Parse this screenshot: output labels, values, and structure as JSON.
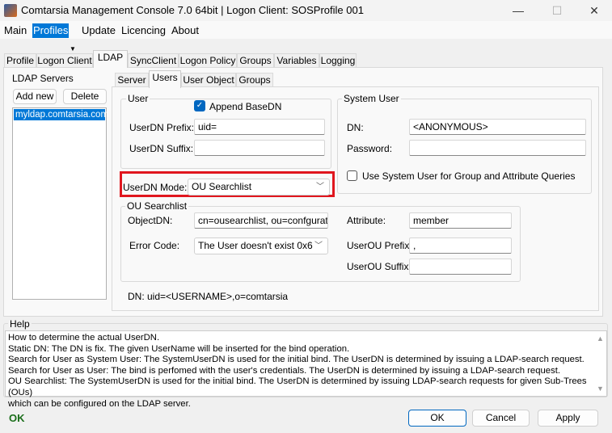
{
  "window": {
    "title": "Comtarsia Management Console 7.0 64bit | Logon Client: SOSProfile 001",
    "minimize": "—",
    "maximize": "☐",
    "close": "✕"
  },
  "menu": [
    {
      "label": "Main"
    },
    {
      "label": "Profiles"
    },
    {
      "label": "Update"
    },
    {
      "label": "Licencing"
    },
    {
      "label": "About"
    }
  ],
  "tabs": [
    {
      "label": "Profile"
    },
    {
      "label": "Logon Client"
    },
    {
      "label": "LDAP"
    },
    {
      "label": "SyncClient"
    },
    {
      "label": "Logon Policy"
    },
    {
      "label": "Groups"
    },
    {
      "label": "Variables"
    },
    {
      "label": "Logging"
    }
  ],
  "ldap_servers": {
    "label": "LDAP Servers",
    "add_button": "Add new",
    "delete_button": "Delete",
    "items": [
      "myldap.comtarsia.com"
    ]
  },
  "subtabs": [
    {
      "label": "Server"
    },
    {
      "label": "Users"
    },
    {
      "label": "User Object"
    },
    {
      "label": "Groups"
    }
  ],
  "user": {
    "group_label": "User",
    "append_basedn_label": "Append BaseDN",
    "append_basedn_checked": true,
    "prefix_label": "UserDN Prefix:",
    "prefix_value": "uid=",
    "suffix_label": "UserDN Suffix:",
    "suffix_value": ""
  },
  "system_user": {
    "group_label": "System User",
    "dn_label": "DN:",
    "dn_value": "<ANONYMOUS>",
    "password_label": "Password:",
    "password_value": "",
    "use_system_label": "Use System User for Group and Attribute Queries",
    "use_system_checked": false
  },
  "userdn_mode": {
    "label": "UserDN Mode:",
    "value": "OU Searchlist",
    "highlight_color": "#e0161e"
  },
  "ou_searchlist": {
    "group_label": "OU Searchlist",
    "objectdn_label": "ObjectDN:",
    "objectdn_value": "cn=ousearchlist, ou=confguration,",
    "error_label": "Error Code:",
    "error_value": "The User doesn't exist 0x6",
    "attribute_label": "Attribute:",
    "attribute_value": "member",
    "ou_prefix_label": "UserOU Prefix:",
    "ou_prefix_value": ",",
    "ou_suffix_label": "UserOU Suffix:",
    "ou_suffix_value": ""
  },
  "dn_preview": "DN: uid=<USERNAME>,o=comtarsia",
  "help": {
    "label": "Help",
    "lines": [
      "How to determine the actual UserDN.",
      "Static DN: The DN is fix. The given UserName will be inserted for the bind operation.",
      "Search for User as System User: The SystemUserDN is used for the initial bind. The UserDN is determined by issuing a LDAP-search request.",
      "Search for User as User: The bind is perfomed with the user's credentials. The UserDN is determined by issuing a LDAP-search request.",
      "OU Searchlist: The SystemUserDN is used for the initial bind. The UserDN is determined by issuing LDAP-search requests for given Sub-Trees (OUs)",
      "which can be configured on the LDAP server."
    ]
  },
  "footer": {
    "status": "OK",
    "status_color": "#1a6e1a",
    "ok": "OK",
    "cancel": "Cancel",
    "apply": "Apply"
  }
}
